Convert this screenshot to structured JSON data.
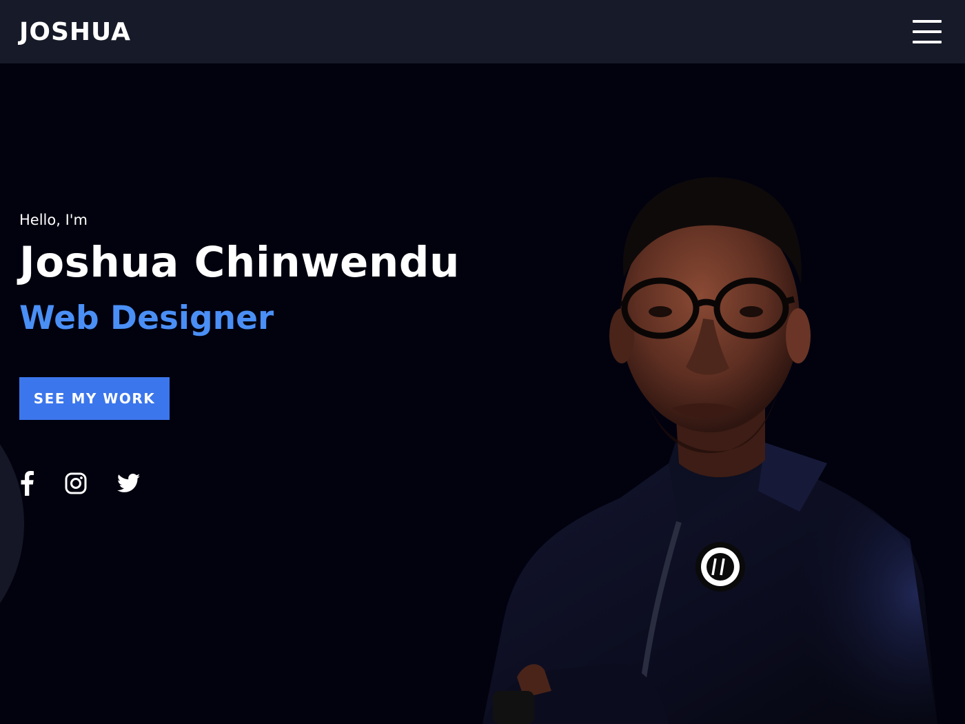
{
  "nav": {
    "logo": "JOSHUA",
    "menu_icon": "hamburger-menu-icon"
  },
  "hero": {
    "greeting": "Hello, I'm",
    "name": "Joshua Chinwendu",
    "role": "Web Designer",
    "cta_label": "SEE MY WORK",
    "portrait_alt": "Joshua Chinwendu"
  },
  "socials": [
    {
      "icon": "facebook-icon"
    },
    {
      "icon": "instagram-icon"
    },
    {
      "icon": "twitter-icon"
    }
  ],
  "colors": {
    "background": "#02020f",
    "navbar": "#171a28",
    "accent_text": "#4a8ff5",
    "button": "#3c76ec"
  }
}
